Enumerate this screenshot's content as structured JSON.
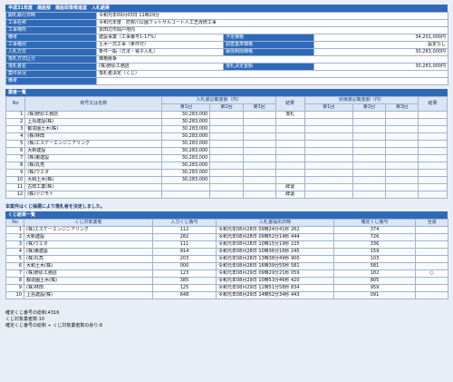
{
  "header": {
    "title": "平成31年度　建設部　建設政策推進室　入札結果"
  },
  "info": {
    "rows": [
      {
        "label": "開札執行日時",
        "value": "令和元年09月03日 11時29分"
      },
      {
        "label": "工事名称",
        "value": "令和元年度　防賀川公園フットサルコート人工芝改修工事"
      },
      {
        "label": "工事場所",
        "value": "京田辺市興戸地内"
      }
    ],
    "split": [
      {
        "l1": "備考",
        "v1": "建設事業（工事番号1-17%）",
        "l2": "予定価格",
        "v2": "34,201,000円"
      },
      {
        "l1": "工事種別",
        "v1": "土木一式工事（条件付）",
        "l2": "調査基準価格",
        "v2": "設定なし"
      },
      {
        "l1": "入札方式",
        "v1": "条件一般（方法・電子入札）",
        "l2": "最低制限価格",
        "v2": "30,283,000円"
      }
    ],
    "rows2": [
      {
        "label": "落札方式区分",
        "value": "価格競争"
      }
    ],
    "winner": {
      "l1": "落札者名",
      "v1": "(株)野原工務店",
      "l2": "落札決定金額",
      "v2": "30,283,000円"
    },
    "rows3": [
      {
        "label": "案件状況",
        "value": "落札者決定（くじ）"
      },
      {
        "label": "備考",
        "value": ""
      }
    ]
  },
  "bidders": {
    "section_title": "業者一覧",
    "col_no": "No",
    "col_name": "商号又は名称",
    "col_amount": "入札書記載金額（円）",
    "col_result": "結果",
    "col_confirm": "見積書記載金額（円）",
    "col_result2": "結果",
    "round1": "第1回",
    "round2": "第2回",
    "round3": "第3回",
    "rows": [
      {
        "no": "1",
        "name": "(株)野原工務店",
        "amt": "30,283,000",
        "res": "落札"
      },
      {
        "no": "2",
        "name": "上島建設(株)",
        "amt": "30,283,000",
        "res": ""
      },
      {
        "no": "3",
        "name": "都造園土木(株)",
        "amt": "30,283,000",
        "res": ""
      },
      {
        "no": "4",
        "name": "(株)林田",
        "amt": "30,283,000",
        "res": ""
      },
      {
        "no": "5",
        "name": "(株)エスケーエンジニアリング",
        "amt": "30,283,000",
        "res": ""
      },
      {
        "no": "6",
        "name": "大新建設",
        "amt": "30,283,000",
        "res": ""
      },
      {
        "no": "7",
        "name": "(株)東建設",
        "amt": "30,283,000",
        "res": ""
      },
      {
        "no": "8",
        "name": "(株)丸亮",
        "amt": "30,283,000",
        "res": ""
      },
      {
        "no": "9",
        "name": "(株)ウエダ",
        "amt": "30,283,000",
        "res": ""
      },
      {
        "no": "10",
        "name": "大和土木(株)",
        "amt": "30,283,000",
        "res": ""
      },
      {
        "no": "11",
        "name": "古田工業(株)",
        "amt": "",
        "res": "辞退"
      },
      {
        "no": "12",
        "name": "(株)ツジモト",
        "amt": "",
        "res": "辞退"
      }
    ]
  },
  "lottery": {
    "note": "本案件はくじ抽選により落札者を決定しました。",
    "section_title": "くじ結果一覧",
    "col_no": "No",
    "col_name": "くじ対象業者",
    "col_num": "入力くじ番号",
    "col_date": "入札書提出日時",
    "col_final": "確定くじ番号",
    "col_mark": "当選",
    "rows": [
      {
        "no": "1",
        "name": "(株)エスケーエンジニアリング",
        "num": "112",
        "date": "令和元年08月28日 09時24分41秒 262",
        "final": "374",
        "mark": ""
      },
      {
        "no": "2",
        "name": "大新建設",
        "num": "282",
        "date": "令和元年08月28日 09時52分14秒 444",
        "final": "726",
        "mark": ""
      },
      {
        "no": "3",
        "name": "(株)ウエダ",
        "num": "111",
        "date": "令和元年08月28日 10時15分19秒 225",
        "final": "336",
        "mark": ""
      },
      {
        "no": "4",
        "name": "(株)東建設",
        "num": "914",
        "date": "令和元年08月28日 10時36分16秒 245",
        "final": "159",
        "mark": ""
      },
      {
        "no": "5",
        "name": "(株)丸亮",
        "num": "203",
        "date": "令和元年08月28日 13時38分49秒 900",
        "final": "103",
        "mark": ""
      },
      {
        "no": "6",
        "name": "大和土木(株)",
        "num": "000",
        "date": "令和元年08月28日 16時39分55秒 581",
        "final": "581",
        "mark": ""
      },
      {
        "no": "7",
        "name": "(株)野原工務店",
        "num": "123",
        "date": "令和元年08月29日 09時29分21秒 059",
        "final": "182",
        "mark": "○"
      },
      {
        "no": "8",
        "name": "都造園土木(株)",
        "num": "385",
        "date": "令和元年08月29日 10時53分46秒 420",
        "final": "805",
        "mark": ""
      },
      {
        "no": "9",
        "name": "(株)林田",
        "num": "125",
        "date": "令和元年08月29日 11時51分58秒 834",
        "final": "959",
        "mark": ""
      },
      {
        "no": "10",
        "name": "上島建設(株)",
        "num": "648",
        "date": "令和元年08月29日 14時52分34秒 443",
        "final": "091",
        "mark": ""
      }
    ]
  },
  "footer": {
    "line1": "確定くじ番号の総和:4316",
    "line2": "くじ対象業者数:10",
    "line3": "確定くじ番号の総和 ÷ くじ対象業者数の余り:6"
  }
}
